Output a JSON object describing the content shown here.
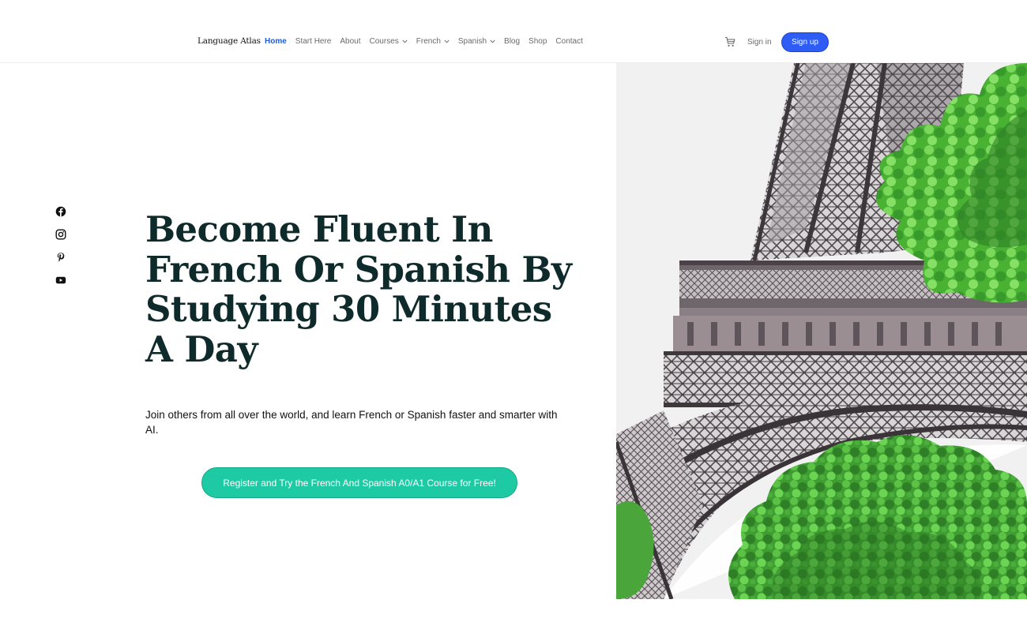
{
  "header": {
    "brand": "Language Atlas",
    "nav": [
      {
        "label": "Home",
        "active": true,
        "dropdown": false
      },
      {
        "label": "Start Here",
        "active": false,
        "dropdown": false
      },
      {
        "label": "About",
        "active": false,
        "dropdown": false
      },
      {
        "label": "Courses",
        "active": false,
        "dropdown": true
      },
      {
        "label": "French",
        "active": false,
        "dropdown": true
      },
      {
        "label": "Spanish",
        "active": false,
        "dropdown": true
      },
      {
        "label": "Blog",
        "active": false,
        "dropdown": false
      },
      {
        "label": "Shop",
        "active": false,
        "dropdown": false
      },
      {
        "label": "Contact",
        "active": false,
        "dropdown": false
      }
    ],
    "cart_icon": "cart-icon",
    "signin_label": "Sign in",
    "signup_label": "Sign up"
  },
  "social": [
    "facebook-icon",
    "instagram-icon",
    "pinterest-icon",
    "youtube-icon"
  ],
  "hero": {
    "title": "Become Fluent In French Or Spanish By Studying 30 Minutes A Day",
    "subtitle": "Join others from all over the world, and learn French or Spanish faster and smarter with AI.",
    "cta_label": "Register and Try the French And Spanish A0/A1 Course for Free!"
  },
  "colors": {
    "nav_active": "#1d5fd8",
    "signup_button": "#2f5cf5",
    "cta_button": "#1dcaa4",
    "title_text": "#0f2a2a"
  }
}
